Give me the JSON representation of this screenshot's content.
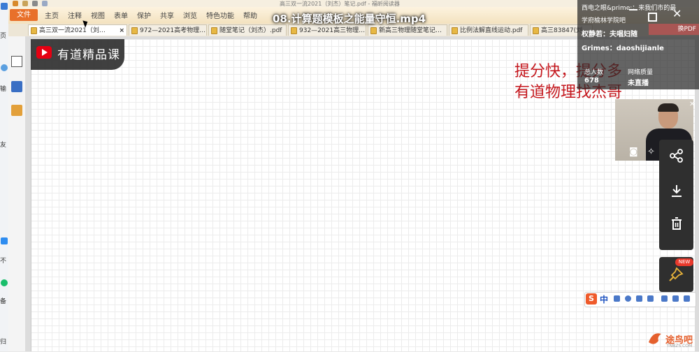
{
  "video": {
    "title": "08.计算题模板之能量守恒.mp4"
  },
  "app": {
    "doc_title": "高三双一流2021（刘杰）笔记.pdf - 福昕阅读器",
    "file_label": "文件",
    "menu": [
      "主页",
      "注释",
      "视图",
      "表单",
      "保护",
      "共享",
      "浏览",
      "特色功能",
      "帮助"
    ],
    "tabs": [
      {
        "label": "高三双一流2021（刘…"
      },
      {
        "label": "972—2021高考物理…"
      },
      {
        "label": "随堂笔记（刘杰）.pdf"
      },
      {
        "label": "932—2021高三物理…"
      },
      {
        "label": "新高三物理随堂笔记…"
      },
      {
        "label": "比例法解直线运动.pdf"
      },
      {
        "label": "高三83847(刘…"
      }
    ],
    "tab_close": "×"
  },
  "logo": {
    "text": "有道精品课"
  },
  "slogan": {
    "line1": "提分快，提分多",
    "line2": "有道物理找杰哥"
  },
  "live": {
    "line1": "西电之眼&prime;：来我们市的最",
    "line2": "学府榆林学院吧",
    "line3": "权静若：夫唱妇随",
    "line4": "Grimes：daoshijianle",
    "total_label": "总人数",
    "total_value": "678",
    "status_label": "网络质量",
    "status_value": "未直播",
    "pdf_badge": "换PDF"
  },
  "left_strip": {
    "labels": [
      "页",
      "输",
      "友",
      "不",
      "备",
      "归"
    ]
  },
  "ime": {
    "label": "中"
  },
  "watermark": {
    "text": "途鸟吧",
    "sub": "TNBZS.COM"
  },
  "colors": {
    "slogan": "#c4161c",
    "file_button": "#e8702a",
    "brand_red": "#e60012"
  }
}
